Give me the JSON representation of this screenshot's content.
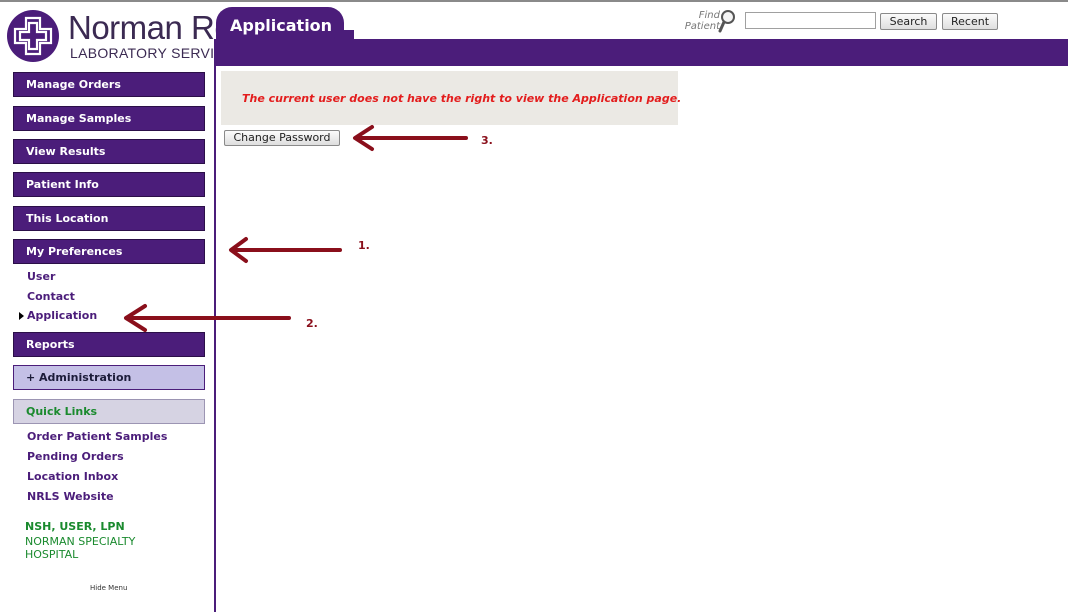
{
  "logo": {
    "name": "Norman Re",
    "subtitle": "LABORATORY SERVICE"
  },
  "header": {
    "title": "Application",
    "find_patient_line1": "Find",
    "find_patient_line2": "Patient",
    "search_value": "",
    "search_label": "Search",
    "recent_label": "Recent"
  },
  "sidebar": {
    "nav": [
      "Manage Orders",
      "Manage Samples",
      "View Results",
      "Patient Info",
      "This Location",
      "My Preferences"
    ],
    "preferences_links": [
      "User",
      "Contact",
      "Application"
    ],
    "reports": "Reports",
    "administration": "+ Administration",
    "quick_links_title": "Quick Links",
    "quick_links": [
      "Order Patient Samples",
      "Pending Orders",
      "Location Inbox",
      "NRLS Website"
    ],
    "user_line": "NSH, USER, LPN",
    "org_line": "NORMAN SPECIALTY HOSPITAL",
    "hide_menu": "Hide Menu"
  },
  "main": {
    "message": "The current user does not have the right to view the Application page.",
    "change_password": "Change Password"
  },
  "annotations": [
    "1.",
    "2.",
    "3."
  ],
  "colors": {
    "brand_purple": "#4b1d7a",
    "error_red": "#e31d1d",
    "link_green": "#1a8a2e",
    "arrow_red": "#8a0f1b"
  }
}
